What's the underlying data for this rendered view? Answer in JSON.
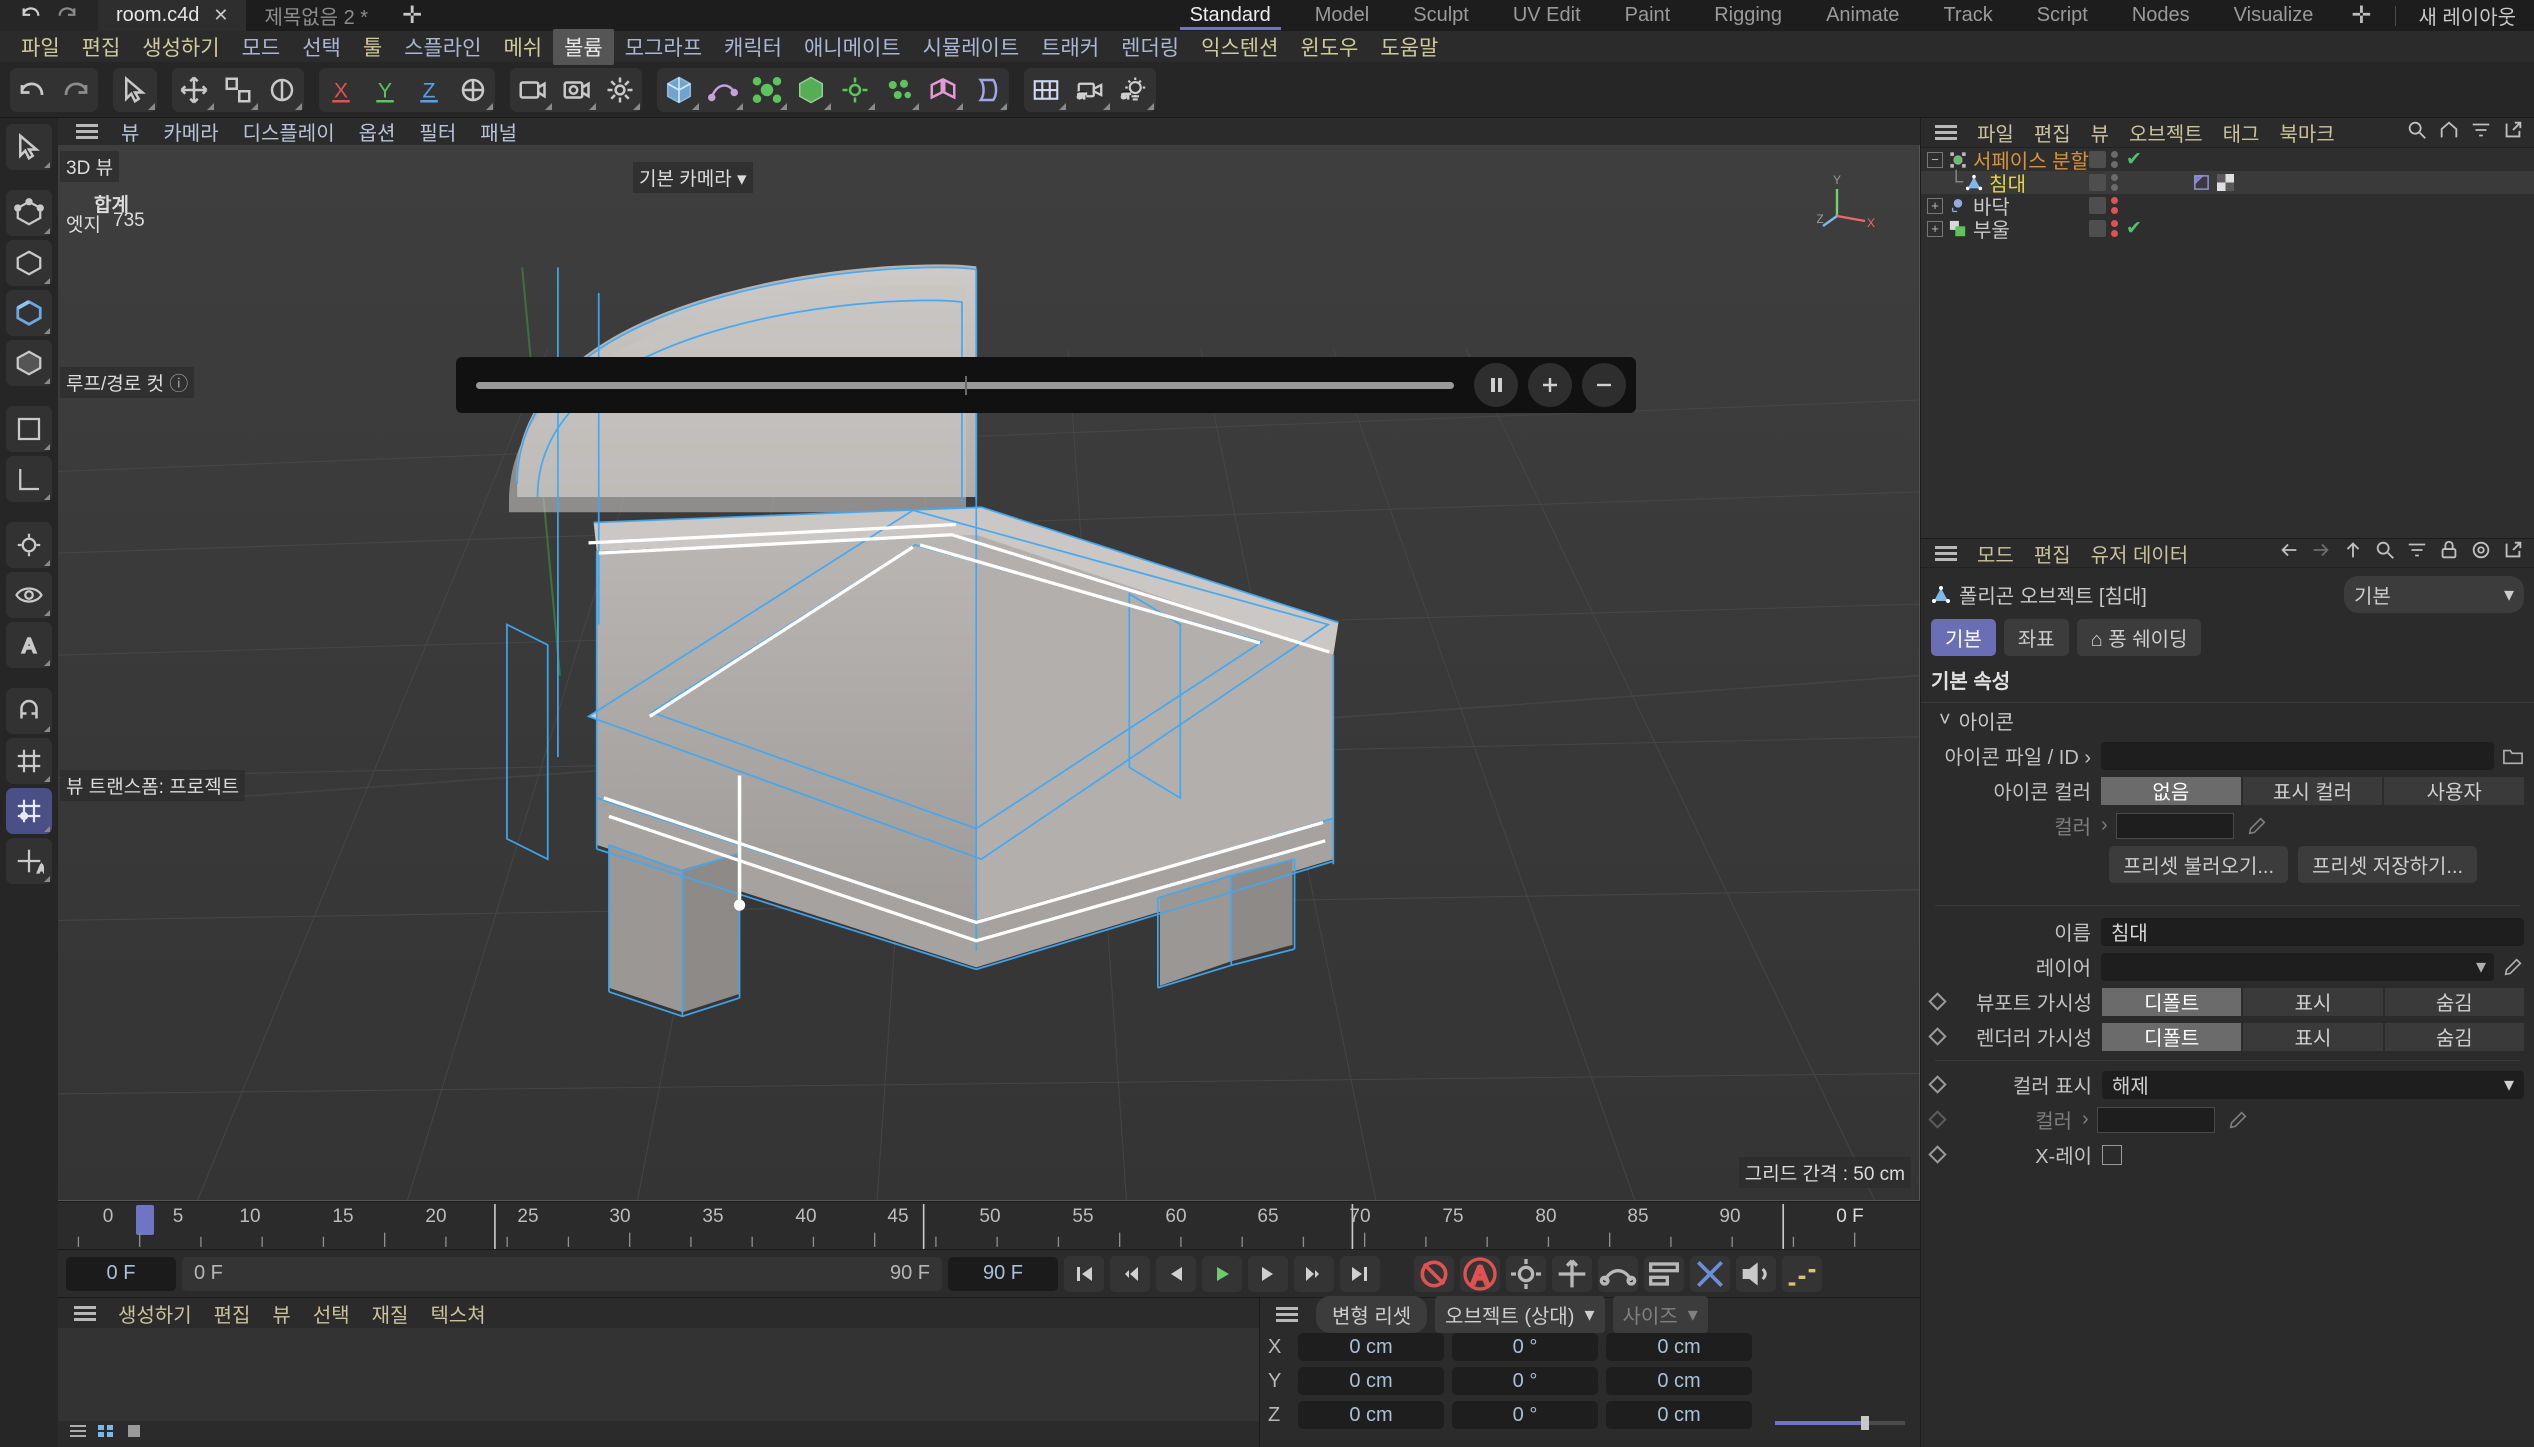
{
  "tabbar": {
    "documents": [
      {
        "name": "room.c4d",
        "active": true,
        "close": "✕"
      },
      {
        "name": "제목없음 2 *",
        "active": false
      }
    ],
    "add_tab": "✛",
    "layouts": [
      "Standard",
      "Model",
      "Sculpt",
      "UV Edit",
      "Paint",
      "Rigging",
      "Animate",
      "Track",
      "Script",
      "Nodes",
      "Visualize"
    ],
    "selected_layout": "Standard",
    "layout_plus": "✛",
    "new_layout_label": "새 레이아웃"
  },
  "menubar": {
    "items": [
      "파일",
      "편집",
      "생성하기",
      "모드",
      "선택",
      "툴",
      "스플라인",
      "메쉬",
      "볼륨",
      "모그라프",
      "캐릭터",
      "애니메이트",
      "시뮬레이트",
      "트래커",
      "렌더링",
      "익스텐션",
      "윈도우",
      "도움말"
    ],
    "highlighted": "볼륨"
  },
  "viewport": {
    "menu": [
      "뷰",
      "카메라",
      "디스플레이",
      "옵션",
      "필터",
      "패널"
    ],
    "view_label": "3D 뷰",
    "stats_header": "합계",
    "stats_row_label": "엣지",
    "stats_row_value": "735",
    "camera_label": "기본 카메라",
    "transform_label": "뷰 트랜스폼: 프로젝트",
    "grid_label": "그리드 간격 : 50 cm",
    "tool_label": "루프/경로 컷",
    "axis": {
      "x": "X",
      "y": "Y",
      "z": "Z"
    }
  },
  "timeline": {
    "ticks": [
      "0",
      "5",
      "10",
      "15",
      "20",
      "25",
      "30",
      "35",
      "40",
      "45",
      "50",
      "55",
      "60",
      "65",
      "70",
      "75",
      "80",
      "85",
      "90"
    ],
    "current_frame_right": "0 F",
    "start_field": "0 F",
    "range_start": "0 F",
    "range_end": "90 F",
    "end_field": "90 F"
  },
  "material_manager": {
    "menu": [
      "생성하기",
      "편집",
      "뷰",
      "선택",
      "재질",
      "텍스쳐"
    ]
  },
  "coordinates": {
    "reset_label": "변형 리셋",
    "mode_label": "오브젝트 (상대)",
    "size_label": "사이즈",
    "rows": [
      {
        "axis": "X",
        "position": "0 cm",
        "rotation": "0 °",
        "scale": "0 cm"
      },
      {
        "axis": "Y",
        "position": "0 cm",
        "rotation": "0 °",
        "scale": "0 cm"
      },
      {
        "axis": "Z",
        "position": "0 cm",
        "rotation": "0 °",
        "scale": "0 cm"
      }
    ]
  },
  "object_manager": {
    "menu": [
      "파일",
      "편집",
      "뷰",
      "오브젝트",
      "태그",
      "북마크"
    ],
    "objects": [
      {
        "name": "서페이스 분할",
        "color": "#d9923d",
        "indent": 0,
        "expander": "−",
        "check": true,
        "dots": [
          "#6b6b6b",
          "#6b6b6b"
        ]
      },
      {
        "name": "침대",
        "color": "#e4d44a",
        "indent": 1,
        "expander": "",
        "check": false,
        "dots": [
          "#6b6b6b",
          "#6b6b6b"
        ],
        "selected": true
      },
      {
        "name": "바닥",
        "color": "#cccccc",
        "indent": 0,
        "expander": "+",
        "check": false,
        "dots": [
          "#e05252",
          "#e05252"
        ]
      },
      {
        "name": "부울",
        "color": "#cccccc",
        "indent": 0,
        "expander": "+",
        "check": true,
        "dots": [
          "#e05252",
          "#e05252"
        ]
      }
    ]
  },
  "attribute_manager": {
    "menu": [
      "모드",
      "편집",
      "유저 데이터"
    ],
    "object_title": "폴리곤 오브젝트 [침대]",
    "preset_dropdown": "기본",
    "tabs": [
      "기본",
      "좌표",
      "퐁 쉐이딩"
    ],
    "active_tab": "기본",
    "section_title": "기본 속성",
    "icon_group": "아이콘",
    "icon_file_label": "아이콘 파일 / ID",
    "icon_file_value": "",
    "icon_color_label": "아이콘 컬러",
    "icon_color_options": [
      "없음",
      "표시 컬러",
      "사용자"
    ],
    "icon_color_selected": "없음",
    "color_label": "컬러",
    "preset_load": "프리셋 불러오기...",
    "preset_save": "프리셋 저장하기...",
    "name_label": "이름",
    "name_value": "침대",
    "layer_label": "레이어",
    "layer_value": "",
    "viewport_vis_label": "뷰포트 가시성",
    "viewport_vis_options": [
      "디폴트",
      "표시",
      "숨김"
    ],
    "viewport_vis_selected": "디폴트",
    "render_vis_label": "렌더러 가시성",
    "render_vis_options": [
      "디폴트",
      "표시",
      "숨김"
    ],
    "render_vis_selected": "디폴트",
    "color_display_label": "컬러 표시",
    "color_display_value": "해제",
    "color2_label": "컬러",
    "xray_label": "X-레이"
  },
  "colors": {
    "accent": "#6f74c4",
    "menu_yellow": "#cfcb9a",
    "selection_blue": "#3fa9f5",
    "object_orange": "#d9923d",
    "object_yellow": "#e4d44a"
  }
}
